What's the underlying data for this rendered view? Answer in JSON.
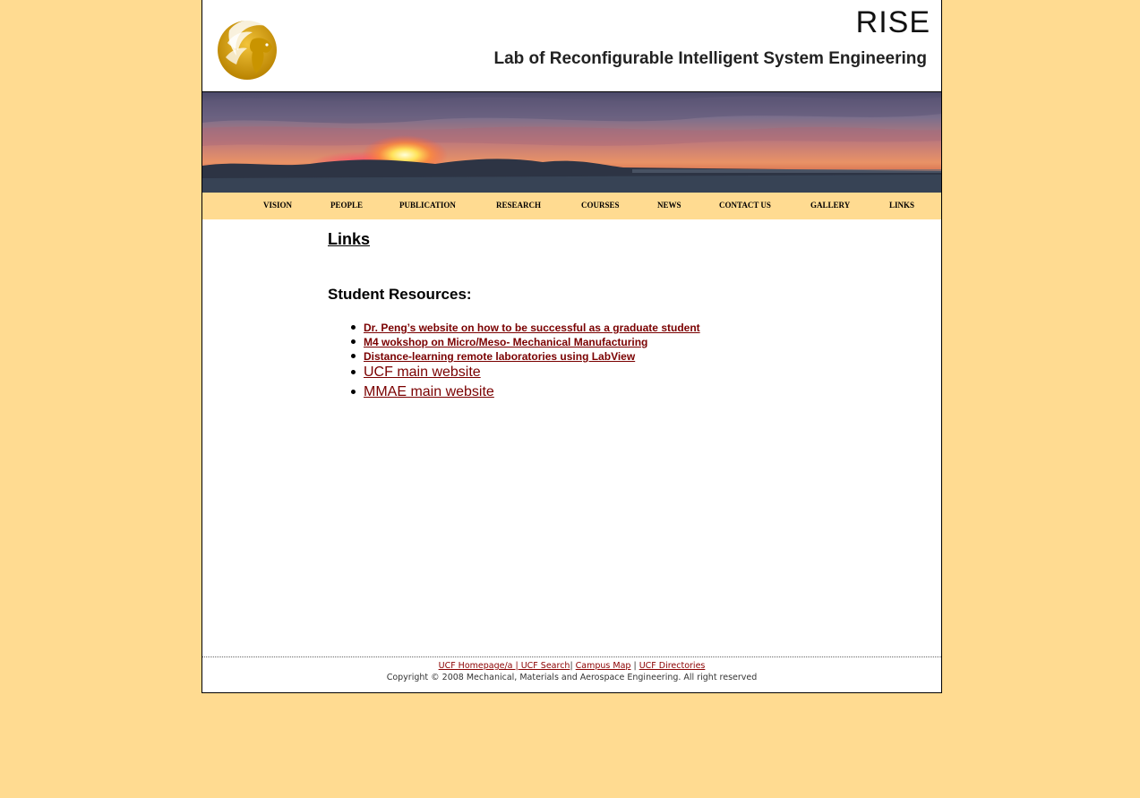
{
  "header": {
    "acronym": "RISE",
    "lab_name": "Lab of Reconfigurable Intelligent System Engineering",
    "logo_icon": "ucf-pegasus-logo-icon"
  },
  "nav": [
    {
      "label": "VISION"
    },
    {
      "label": "PEOPLE"
    },
    {
      "label": "PUBLICATION"
    },
    {
      "label": "RESEARCH"
    },
    {
      "label": "COURSES"
    },
    {
      "label": "NEWS"
    },
    {
      "label": "CONTACT US"
    },
    {
      "label": "GALLERY"
    },
    {
      "label": "LINKS"
    }
  ],
  "content": {
    "title": "Links",
    "section_title": "Student Resources:",
    "links": [
      {
        "label": "Dr. Peng’s website on how to be successful as a graduate student"
      },
      {
        "label": "M4 wokshop on Micro/Meso- Mechanical Manufacturing"
      },
      {
        "label": "Distance-learning remote laboratories using LabView"
      },
      {
        "label": "UCF main website"
      },
      {
        "label": "MMAE main website"
      }
    ]
  },
  "footer": {
    "link1": "UCF Homepage/a | UCF Search",
    "sep1": "|",
    "link2": "Campus Map",
    "sep2": " | ",
    "link3": "UCF Directories",
    "copyright": "Copyright © 2008 Mechanical, Materials and Aerospace Engineering. All right reserved"
  },
  "colors": {
    "page_background": "#ffdb91",
    "link_color": "#7a0000",
    "nav_background": "#ffdb91"
  }
}
